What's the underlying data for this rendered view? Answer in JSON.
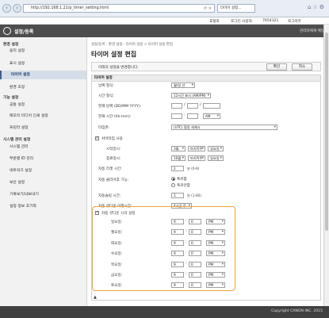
{
  "browser": {
    "url": "http://192.168.1.21/p_timer_setting.html",
    "tab_title": "타이머 설정...",
    "back_icon": "back-arrow-icon",
    "forward_icon": "forward-arrow-icon"
  },
  "userbar": {
    "portal": "포털로",
    "login_user_label": "로그인 사용자:",
    "login_user": "7654321",
    "logout": "로그아웃"
  },
  "app": {
    "title": "설정/등록",
    "admin_mail": "관리자에게 메일"
  },
  "sidebar": {
    "groups": [
      "환경 설정",
      "기능 설정",
      "시스템 관리 설정"
    ],
    "items": [
      "용지 설정",
      "표시 설정",
      "타이머 설정",
      "환경 조정",
      "공통 설정",
      "메모리 미디어 인쇄 설정",
      "프린터 설정",
      "시스템 관리",
      "부문별 ID 관리",
      "네트워크 설정",
      "보안 설정",
      "기록보기/내보내기",
      "설정 정보 초기화"
    ]
  },
  "content": {
    "breadcrumb": "설정/등록 : 환경 설정 : 타이머 설정 > 타이머 설정 편집",
    "page_title": "타이머 설정 편집",
    "message": "아래의 설정을 변경합니다.",
    "ok": "확인",
    "cancel": "취소",
    "panel_title": "타이머 설정",
    "date_format_label": "날짜 형식:",
    "date_format_value": "월/일 년",
    "time_format_label": "시간 형식:",
    "time_format_value": "12시간 표시 (AM/PM)",
    "current_date_label": "현재 날짜 (DD/MM YYYY):",
    "date_sep": "/",
    "current_time_label": "현재 시간 (hh:mm):",
    "time_sep": ":",
    "ampm": "AM",
    "timezone_label": "타임존:",
    "timezone_value": "(UTC) 협정 세계시",
    "dst_label": "서머타임 사용",
    "dst_start_label": "시작일시:",
    "dst_start": [
      "3월",
      "마지막주",
      "일요일"
    ],
    "dst_end_label": "종료일시:",
    "dst_end": [
      "10월",
      "마지막주",
      "일요일"
    ],
    "auto_reset_label": "자동 리셋 시간:",
    "auto_reset_value": "2",
    "auto_reset_hint": "분 (0-9)",
    "after_reset_label": "자동 클리어후 기능:",
    "after_reset_opt1": "폭귀함",
    "after_reset_opt2": "폭귀안함",
    "auto_sleep_label": "자동슬립 시간:",
    "auto_sleep_value": "1",
    "auto_sleep_hint": "분 (1-60)",
    "quiet_label": "자동 셧다운 이행시간:",
    "quiet_value": "4시간 후",
    "weekly_label": "자동 셧다운 시각 설정",
    "days": [
      "일요일:",
      "월요일:",
      "화요일:",
      "수요일:",
      "목요일:",
      "금요일:",
      "토요일:"
    ],
    "hour": "9",
    "minute": "0",
    "pm": "PM",
    "page_top": "▲"
  },
  "footer": {
    "copyright": "Copyright CANON INC. 2015"
  }
}
